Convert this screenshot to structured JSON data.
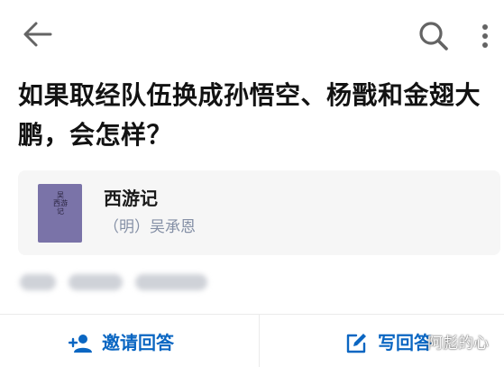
{
  "header": {
    "back_icon": "arrow-left-icon",
    "search_icon": "search-icon",
    "more_icon": "more-vertical-icon",
    "icon_color": "#646464"
  },
  "question": {
    "title": "如果取经队伍换成孙悟空、杨戬和金翅大鹏，会怎样？"
  },
  "book_card": {
    "cover_text": "吴 西游记",
    "title": "西游记",
    "author": "（明）吴承恩",
    "cover_color": "#7a73a8"
  },
  "actions": {
    "invite_label": "邀请回答",
    "invite_icon": "person-add-icon",
    "write_label": "写回答",
    "write_icon": "edit-icon",
    "accent_color": "#0a66c2"
  },
  "watermark": {
    "text": "阿彪的心"
  }
}
